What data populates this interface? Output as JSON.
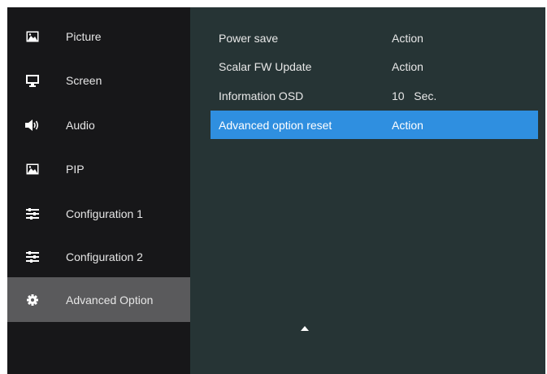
{
  "sidebar": {
    "items": [
      {
        "label": "Picture",
        "icon": "picture-icon"
      },
      {
        "label": "Screen",
        "icon": "monitor-icon"
      },
      {
        "label": "Audio",
        "icon": "speaker-icon"
      },
      {
        "label": "PIP",
        "icon": "pip-icon"
      },
      {
        "label": "Configuration 1",
        "icon": "sliders-icon"
      },
      {
        "label": "Configuration 2",
        "icon": "sliders-icon"
      },
      {
        "label": "Advanced Option",
        "icon": "gear-icon",
        "selected": true
      }
    ]
  },
  "main": {
    "rows": [
      {
        "label": "Power save",
        "value": "Action"
      },
      {
        "label": "Scalar FW Update",
        "value": "Action"
      },
      {
        "label": "Information OSD",
        "value": "10   Sec."
      },
      {
        "label": "Advanced option reset",
        "value": "Action",
        "selected": true
      }
    ],
    "scroll_indicator": "up-arrow-icon"
  },
  "colors": {
    "sidebar_bg": "#171719",
    "sidebar_selected": "#5a5a5c",
    "main_bg": "#263435",
    "row_selected": "#2f8fe0"
  }
}
